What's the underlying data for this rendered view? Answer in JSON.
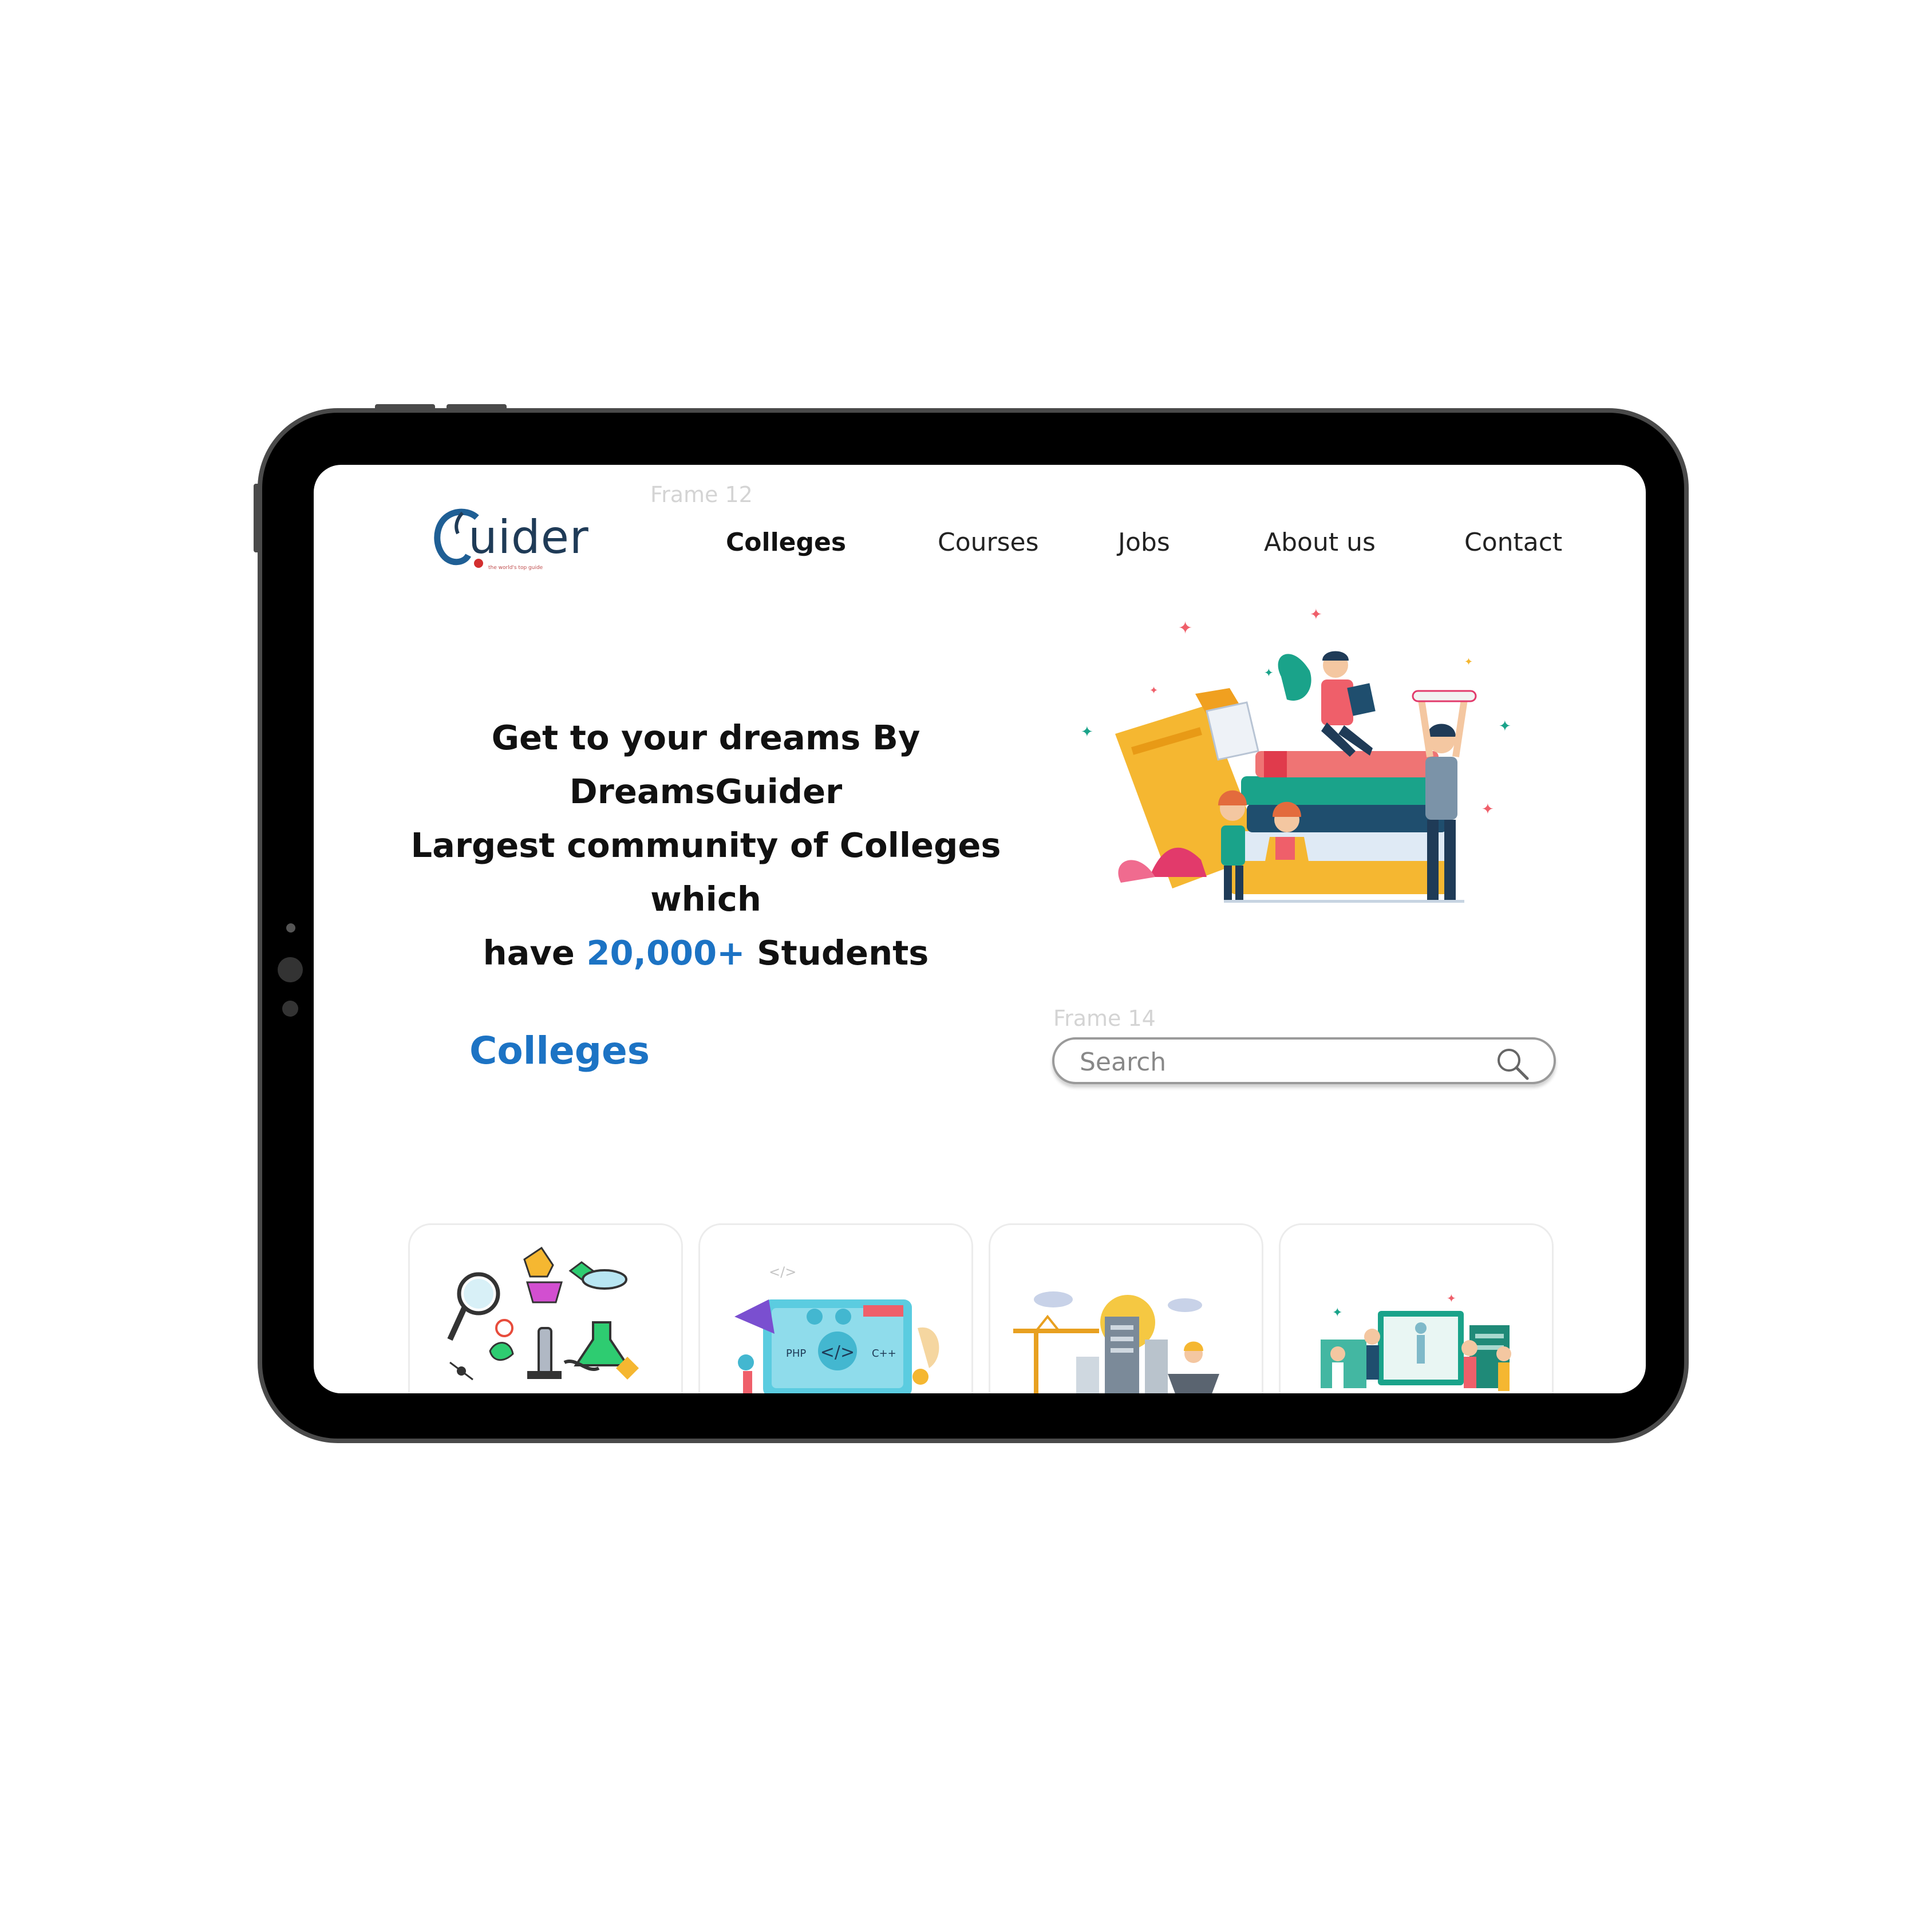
{
  "canvas": {
    "frame_label_nav": "Frame 12",
    "frame_label_search": "Frame 14"
  },
  "brand": {
    "logo_text": "uider",
    "logo_initial": "G",
    "tagline": "the world's top guide"
  },
  "nav": {
    "items": [
      {
        "label": "Colleges",
        "active": true
      },
      {
        "label": "Courses",
        "active": false
      },
      {
        "label": "Jobs",
        "active": false
      },
      {
        "label": "About us",
        "active": false
      },
      {
        "label": "Contact",
        "active": false
      }
    ]
  },
  "hero": {
    "line1": "Get to your dreams By DreamsGuider",
    "line2": "Largest community of Colleges which",
    "line3_pre": "have ",
    "line3_highlight": "20,000+",
    "line3_post": " Students"
  },
  "colleges": {
    "title": "Colleges",
    "search": {
      "placeholder": "Search",
      "value": ""
    },
    "cards": [
      {
        "icon": "science-icon"
      },
      {
        "icon": "coding-icon"
      },
      {
        "icon": "construction-icon"
      },
      {
        "icon": "medical-icon"
      }
    ]
  },
  "colors": {
    "accent": "#1c73c4",
    "tablet_body": "#000000",
    "tablet_frame": "#4a4a4a"
  }
}
